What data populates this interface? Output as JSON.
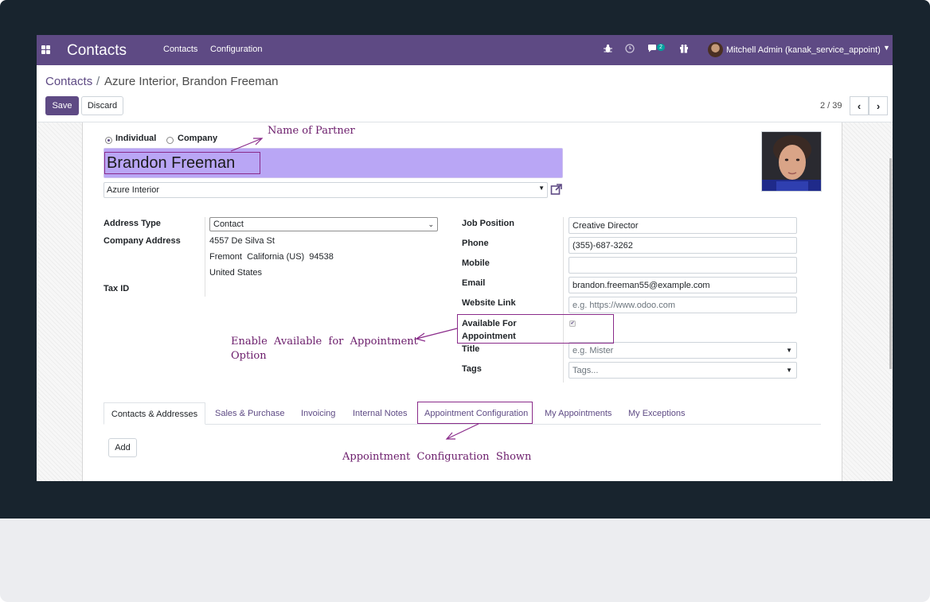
{
  "navbar": {
    "app_name": "Contacts",
    "menu": [
      "Contacts",
      "Configuration"
    ],
    "chat_badge": "2",
    "user": "Mitchell Admin (kanak_service_appoint)"
  },
  "breadcrumb": {
    "parent": "Contacts",
    "separator": "/",
    "current": "Azure Interior, Brandon Freeman"
  },
  "buttons": {
    "save": "Save",
    "discard": "Discard",
    "add": "Add"
  },
  "pager": {
    "value": "2 / 39"
  },
  "form": {
    "type_options": [
      "Individual",
      "Company"
    ],
    "selected_type": "Individual",
    "name": "Brandon Freeman",
    "company": "Azure Interior",
    "left_labels": {
      "address_type": "Address Type",
      "company_address": "Company Address",
      "tax_id": "Tax ID"
    },
    "address_type_value": "Contact",
    "address_lines": [
      "4557 De Silva St",
      "Fremont  California (US)  94538",
      "United States"
    ],
    "right_labels": {
      "job_position": "Job Position",
      "phone": "Phone",
      "mobile": "Mobile",
      "email": "Email",
      "website": "Website Link",
      "available_line1": "Available For",
      "available_line2": "Appointment",
      "title": "Title",
      "tags": "Tags"
    },
    "values": {
      "job_position": "Creative Director",
      "phone": "(355)-687-3262",
      "mobile": "",
      "email": "brandon.freeman55@example.com"
    },
    "placeholders": {
      "website": "e.g. https://www.odoo.com",
      "title": "e.g. Mister",
      "tags": "Tags..."
    },
    "available_for_appointment": true
  },
  "tabs": [
    "Contacts & Addresses",
    "Sales & Purchase",
    "Invoicing",
    "Internal Notes",
    "Appointment Configuration",
    "My Appointments",
    "My Exceptions"
  ],
  "annotations": {
    "name_of_partner": "Name of Partner",
    "enable_line1": "Enable  Available  for  Appointment",
    "enable_line2": "Option",
    "config_shown": "Appointment  Configuration  Shown"
  },
  "colors": {
    "brand": "#5e4a84",
    "frame": "#18242e",
    "annotation": "#8a2b8a",
    "name_highlight": "#b9a6f5"
  }
}
